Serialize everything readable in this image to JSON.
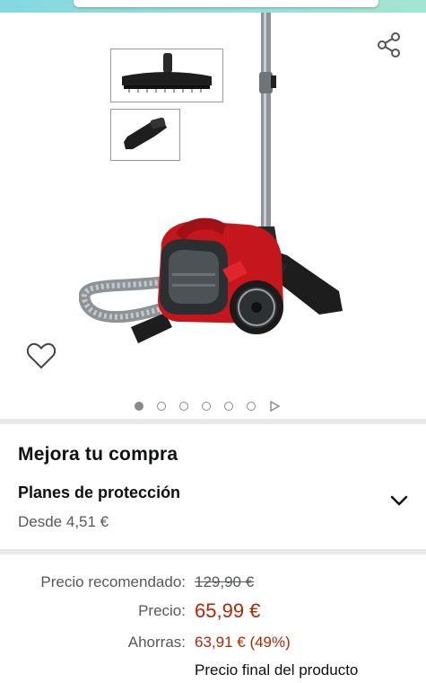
{
  "gallery": {
    "share_icon": "share-icon",
    "favorite_icon": "heart-outline-icon",
    "image_count": 6,
    "active_index": 0,
    "product_color": "#c4161c"
  },
  "upgrade": {
    "title": "Mejora tu compra",
    "plans_title": "Planes de protección",
    "plans_price": "Desde 4,51 €"
  },
  "pricing": {
    "recommended_label": "Precio recomendado:",
    "recommended_value": "129,90 €",
    "price_label": "Precio:",
    "price_value": "65,99 €",
    "savings_label": "Ahorras:",
    "savings_value": "63,91 € (49%)",
    "final_note": "Precio final del producto",
    "accent_color": "#b12704"
  }
}
